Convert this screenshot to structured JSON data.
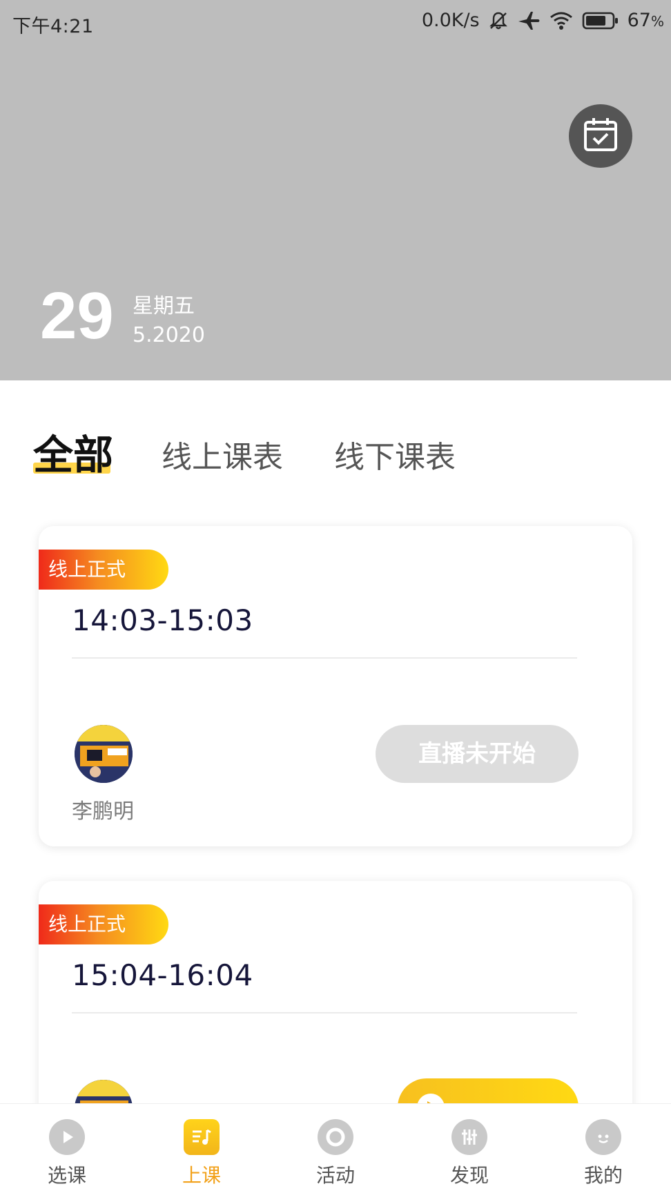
{
  "status_bar": {
    "time": "下午4:21",
    "network_speed": "0.0K/s",
    "battery": "67",
    "battery_suffix": "%"
  },
  "header": {
    "day": "29",
    "weekday": "星期五",
    "month_year": "5.2020",
    "calendar_icon": "calendar-check-icon"
  },
  "tabs": [
    {
      "label": "全部",
      "active": true
    },
    {
      "label": "线上课表",
      "active": false
    },
    {
      "label": "线下课表",
      "active": false
    }
  ],
  "cards": [
    {
      "badge": "线上正式",
      "time": "14:03-15:03",
      "teacher": "李鹏明",
      "action": "直播未开始",
      "action_state": "disabled"
    },
    {
      "badge": "线上正式",
      "time": "15:04-16:04",
      "teacher": "",
      "action": "",
      "action_state": "replay"
    }
  ],
  "bottom_nav": [
    {
      "label": "选课",
      "icon": "play-icon",
      "active": false
    },
    {
      "label": "上课",
      "icon": "music-list-icon",
      "active": true
    },
    {
      "label": "活动",
      "icon": "target-icon",
      "active": false
    },
    {
      "label": "发现",
      "icon": "equalizer-icon",
      "active": false
    },
    {
      "label": "我的",
      "icon": "face-icon",
      "active": false
    }
  ],
  "colors": {
    "header_bg": "#bdbdbd",
    "accent": "#ffd54a",
    "badge_start": "#ef2a1a",
    "badge_end": "#ffd913",
    "nav_active": "#f2a11a"
  }
}
